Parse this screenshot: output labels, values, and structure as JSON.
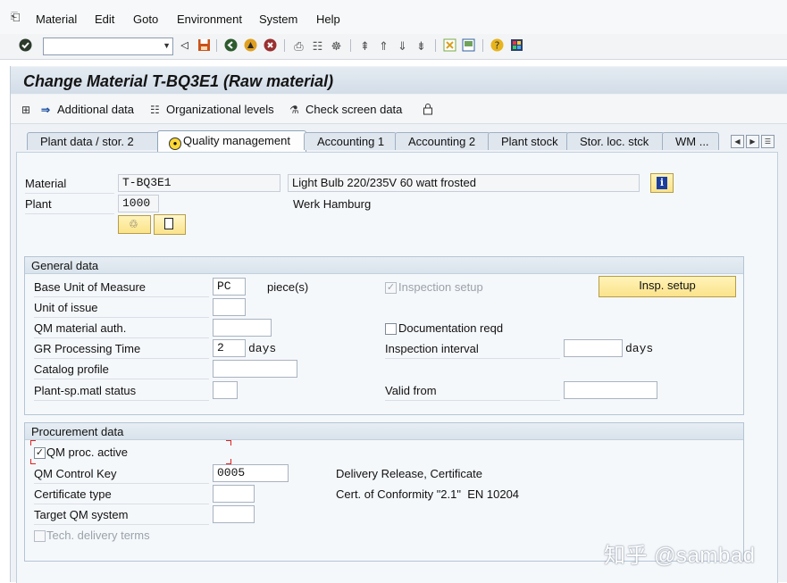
{
  "menubar": {
    "items": [
      {
        "label": "Material"
      },
      {
        "label": "Edit"
      },
      {
        "label": "Goto"
      },
      {
        "label": "Environment"
      },
      {
        "label": "System"
      },
      {
        "label": "Help"
      }
    ]
  },
  "toolbar": {
    "command_field_value": ""
  },
  "page": {
    "title": "Change Material T-BQ3E1 (Raw material)"
  },
  "app_toolbar": {
    "additional_data": "Additional data",
    "org_levels": "Organizational levels",
    "check_screen": "Check screen data"
  },
  "tabs": [
    {
      "label": "Plant data / stor. 2",
      "active": false
    },
    {
      "label": "Quality management",
      "active": true
    },
    {
      "label": "Accounting 1",
      "active": false
    },
    {
      "label": "Accounting 2",
      "active": false
    },
    {
      "label": "Plant stock",
      "active": false
    },
    {
      "label": "Stor. loc. stck",
      "active": false
    },
    {
      "label": "WM ...",
      "active": false
    }
  ],
  "header": {
    "material_label": "Material",
    "material_value": "T-BQ3E1",
    "material_desc": "Light Bulb 220/235V 60 watt frosted",
    "plant_label": "Plant",
    "plant_value": "1000",
    "plant_name": "Werk Hamburg"
  },
  "general": {
    "title": "General data",
    "base_uom_label": "Base Unit of Measure",
    "base_uom_value": "PC",
    "base_uom_text": "piece(s)",
    "unit_issue_label": "Unit of issue",
    "qm_auth_label": "QM material auth.",
    "gr_time_label": "GR Processing Time",
    "gr_time_value": "2",
    "gr_time_unit": "days",
    "catalog_label": "Catalog profile",
    "status_label": "Plant-sp.matl status",
    "insp_setup_chk_label": "Inspection setup",
    "insp_setup_btn": "Insp. setup",
    "doc_reqd_label": "Documentation reqd",
    "insp_interval_label": "Inspection interval",
    "insp_interval_unit": "days",
    "valid_from_label": "Valid from"
  },
  "procurement": {
    "title": "Procurement data",
    "qm_active_label": "QM proc. active",
    "control_key_label": "QM Control Key",
    "control_key_value": "0005",
    "control_key_desc": "Delivery Release, Certificate",
    "cert_type_label": "Certificate type",
    "cert_type_desc": "Cert. of Conformity \"2.1\"  EN 10204",
    "target_qm_label": "Target QM system",
    "tech_delivery_label": "Tech. delivery terms"
  },
  "watermark": "知乎 @sambad"
}
